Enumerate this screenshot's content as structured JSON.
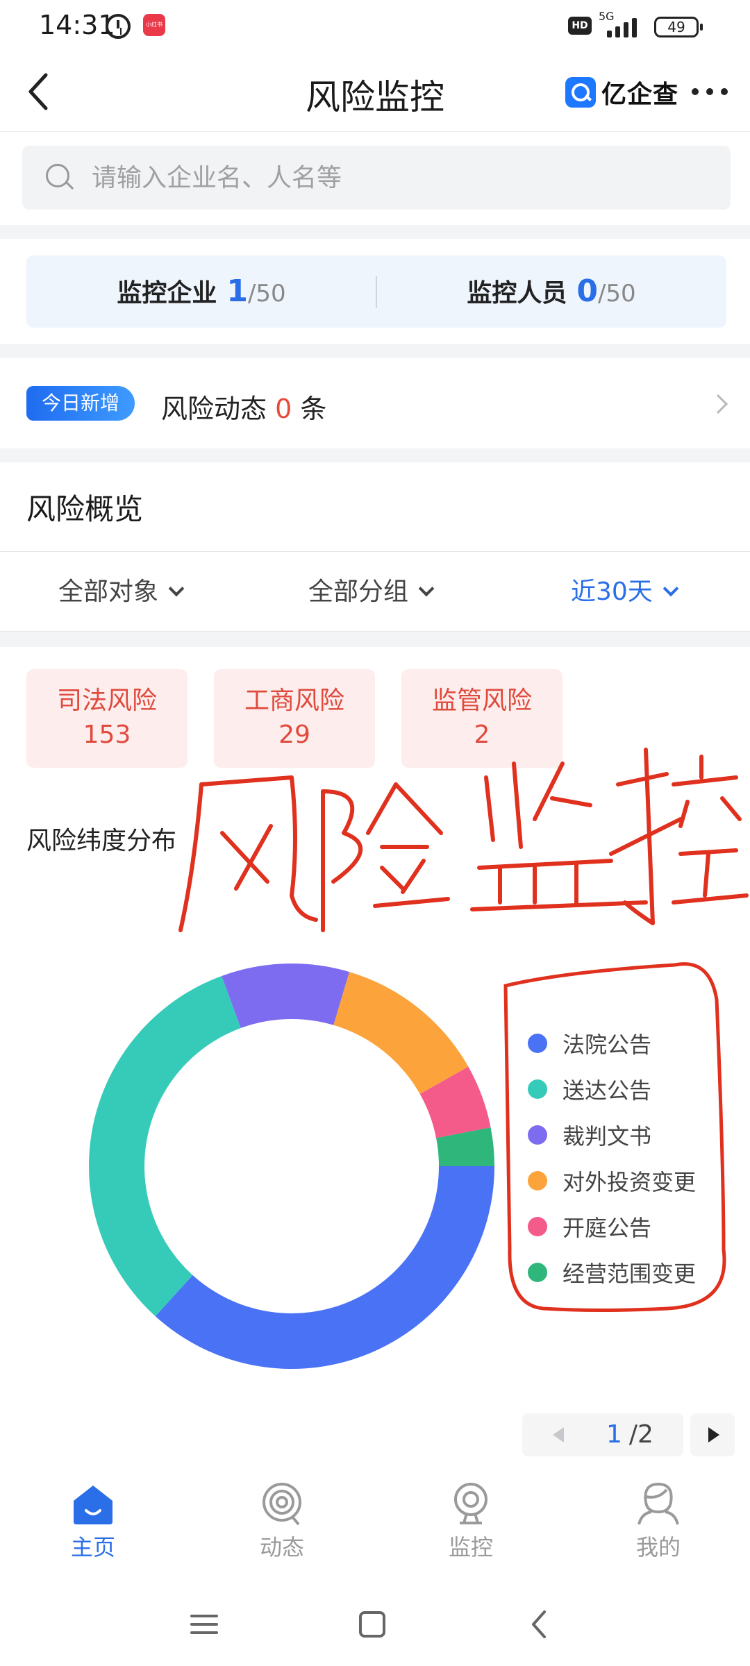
{
  "status_bar": {
    "time": "14:31",
    "app_badge": "小红书",
    "network": "5G",
    "battery": "49"
  },
  "header": {
    "title": "风险监控",
    "logo_text": "亿企查"
  },
  "search": {
    "placeholder": "请输入企业名、人名等"
  },
  "monitor": {
    "company_label": "监控企业",
    "company_count": "1",
    "company_total": "/50",
    "person_label": "监控人员",
    "person_count": "0",
    "person_total": "/50"
  },
  "today": {
    "badge": "今日新增",
    "prefix": "风险动态",
    "count": "0",
    "suffix": "条"
  },
  "overview": {
    "title": "风险概览",
    "filters": [
      {
        "label": "全部对象"
      },
      {
        "label": "全部分组"
      },
      {
        "label": "近30天",
        "active": true
      }
    ],
    "risk_cards": [
      {
        "label": "司法风险",
        "value": "153"
      },
      {
        "label": "工商风险",
        "value": "29"
      },
      {
        "label": "监管风险",
        "value": "2"
      }
    ],
    "distribution_title": "风险纬度分布",
    "handwriting": "风险监控"
  },
  "chart_data": {
    "type": "pie",
    "donut": true,
    "categories": [
      "法院公告",
      "送达公告",
      "裁判文书",
      "对外投资变更",
      "开庭公告",
      "经营范围变更"
    ],
    "values": [
      36,
      32,
      10,
      12,
      5,
      3
    ],
    "colors": [
      "#4a72f5",
      "#36cbb9",
      "#7d6cf0",
      "#fca33c",
      "#f45a8a",
      "#2fb67a"
    ]
  },
  "pager": {
    "current": "1",
    "total": "/2"
  },
  "bottom_nav": [
    {
      "label": "主页",
      "icon": "home-icon",
      "active": true
    },
    {
      "label": "动态",
      "icon": "activity-icon"
    },
    {
      "label": "监控",
      "icon": "monitor-camera-icon"
    },
    {
      "label": "我的",
      "icon": "profile-icon"
    }
  ],
  "colors": {
    "accent": "#2a6ee8",
    "danger": "#e04a3c",
    "card_bg": "#fdeded",
    "annotation": "#e0301e"
  }
}
